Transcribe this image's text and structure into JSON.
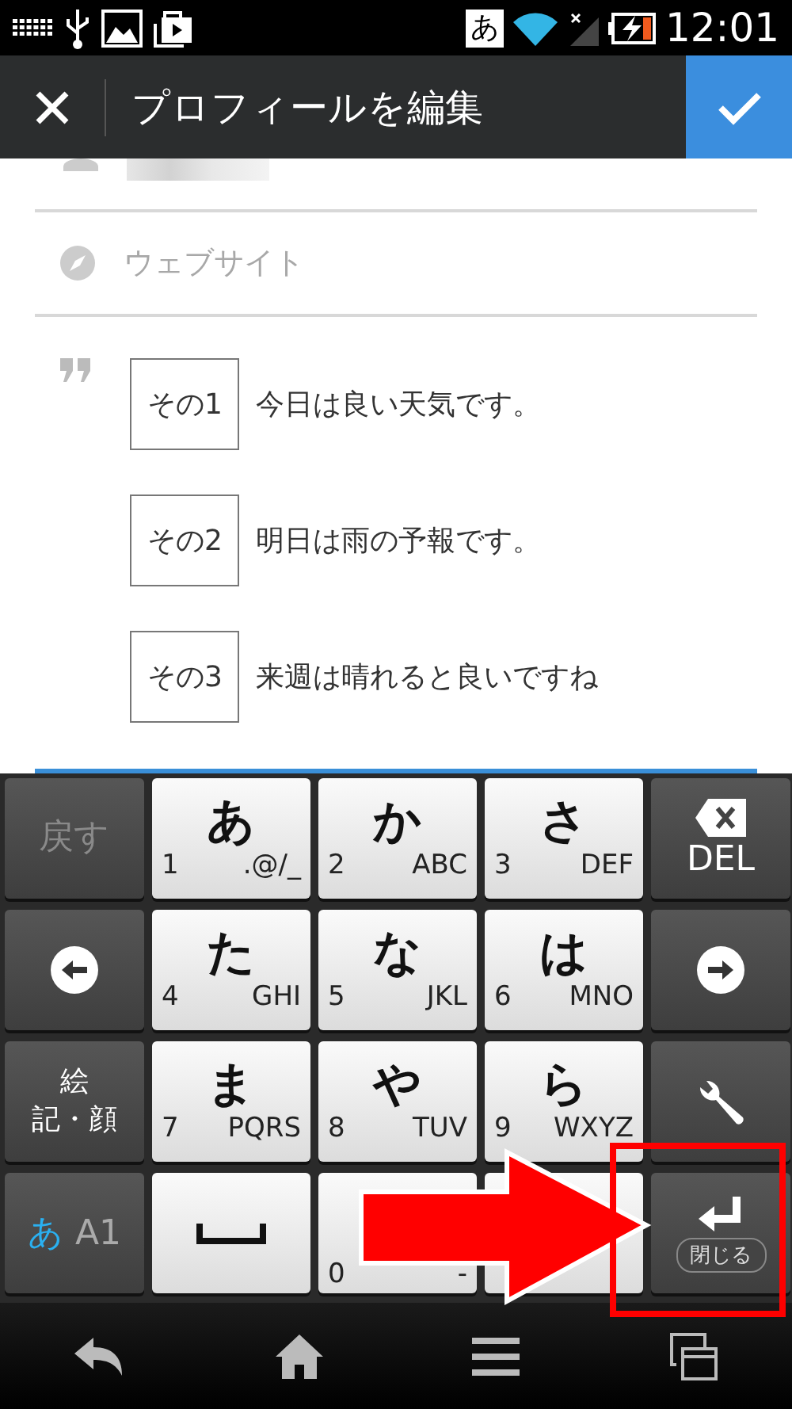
{
  "status_bar": {
    "ime_badge": "あ",
    "time": "12:01"
  },
  "app_bar": {
    "title": "プロフィールを編集"
  },
  "website_field": {
    "placeholder": "ウェブサイト"
  },
  "bio_field": {
    "focused": true,
    "lines": [
      {
        "tag": "その1",
        "text": "今日は良い天気です。"
      },
      {
        "tag": "その2",
        "text": "明日は雨の予報です。"
      },
      {
        "tag": "その3",
        "text": "来週は晴れると良いですね"
      }
    ]
  },
  "keyboard": {
    "rows": [
      [
        {
          "kind": "func",
          "lines": [
            "戻す"
          ],
          "disabled": true
        },
        {
          "kind": "kana",
          "main": "あ",
          "num": "1",
          "letters": ".@/_"
        },
        {
          "kind": "kana",
          "main": "か",
          "num": "2",
          "letters": "ABC"
        },
        {
          "kind": "kana",
          "main": "さ",
          "num": "3",
          "letters": "DEF"
        },
        {
          "kind": "backspace",
          "label": "DEL"
        }
      ],
      [
        {
          "kind": "cursor-left"
        },
        {
          "kind": "kana",
          "main": "た",
          "num": "4",
          "letters": "GHI"
        },
        {
          "kind": "kana",
          "main": "な",
          "num": "5",
          "letters": "JKL"
        },
        {
          "kind": "kana",
          "main": "は",
          "num": "6",
          "letters": "MNO"
        },
        {
          "kind": "cursor-right"
        }
      ],
      [
        {
          "kind": "func",
          "lines": [
            "絵",
            "記・顔"
          ],
          "disabled": false
        },
        {
          "kind": "kana",
          "main": "ま",
          "num": "7",
          "letters": "PQRS"
        },
        {
          "kind": "kana",
          "main": "や",
          "num": "8",
          "letters": "TUV"
        },
        {
          "kind": "kana",
          "main": "ら",
          "num": "9",
          "letters": "WXYZ"
        },
        {
          "kind": "settings"
        }
      ],
      [
        {
          "kind": "mode",
          "kana": "あ",
          "rest": "A1"
        },
        {
          "kind": "space"
        },
        {
          "kind": "kana",
          "num": "0",
          "letters": "-"
        },
        {
          "kind": "kana"
        },
        {
          "kind": "enter",
          "label": "閉じる"
        }
      ]
    ]
  }
}
